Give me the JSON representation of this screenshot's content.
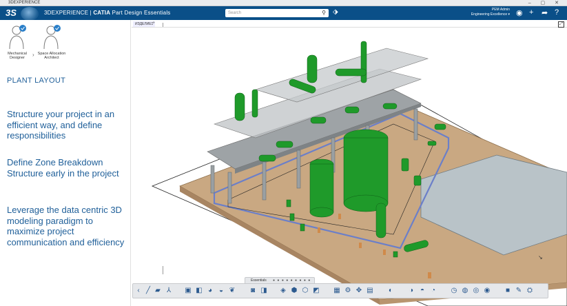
{
  "window": {
    "title": "3DEXPERIENCE",
    "controls": "– ▢ ✕"
  },
  "topbar": {
    "logo": "3S",
    "app_prefix": "3DEXPERIENCE",
    "app_brand": "CATIA",
    "app_name": "Part Design Essentials",
    "search_placeholder": "Search",
    "user_name": "PEM Admin",
    "user_context": "Engineering Excellence ▾"
  },
  "roles": [
    {
      "label": "Mechanical Designer"
    },
    {
      "label": "Space Allocation Architect"
    }
  ],
  "left": {
    "section_title": "PLANT LAYOUT",
    "bullets": [
      "Structure your project in an efficient way, and define responsibilities",
      "Define Zone Breakdown Structure early in the project",
      "Leverage the data centric 3D modeling paradigm to maximize project communication and efficiency"
    ]
  },
  "canvas": {
    "tab_label": "ИЗДЕЛИЕ1",
    "tab_plus": "+"
  },
  "toolbar": {
    "section_label": "Essentials",
    "pager": "● ● ● ● ● ● ● ● ●"
  },
  "colors": {
    "brand_blue": "#0a4f88",
    "text_blue": "#1f5f99",
    "equipment_green": "#1f9a2a",
    "ground_tan": "#c9a882"
  }
}
